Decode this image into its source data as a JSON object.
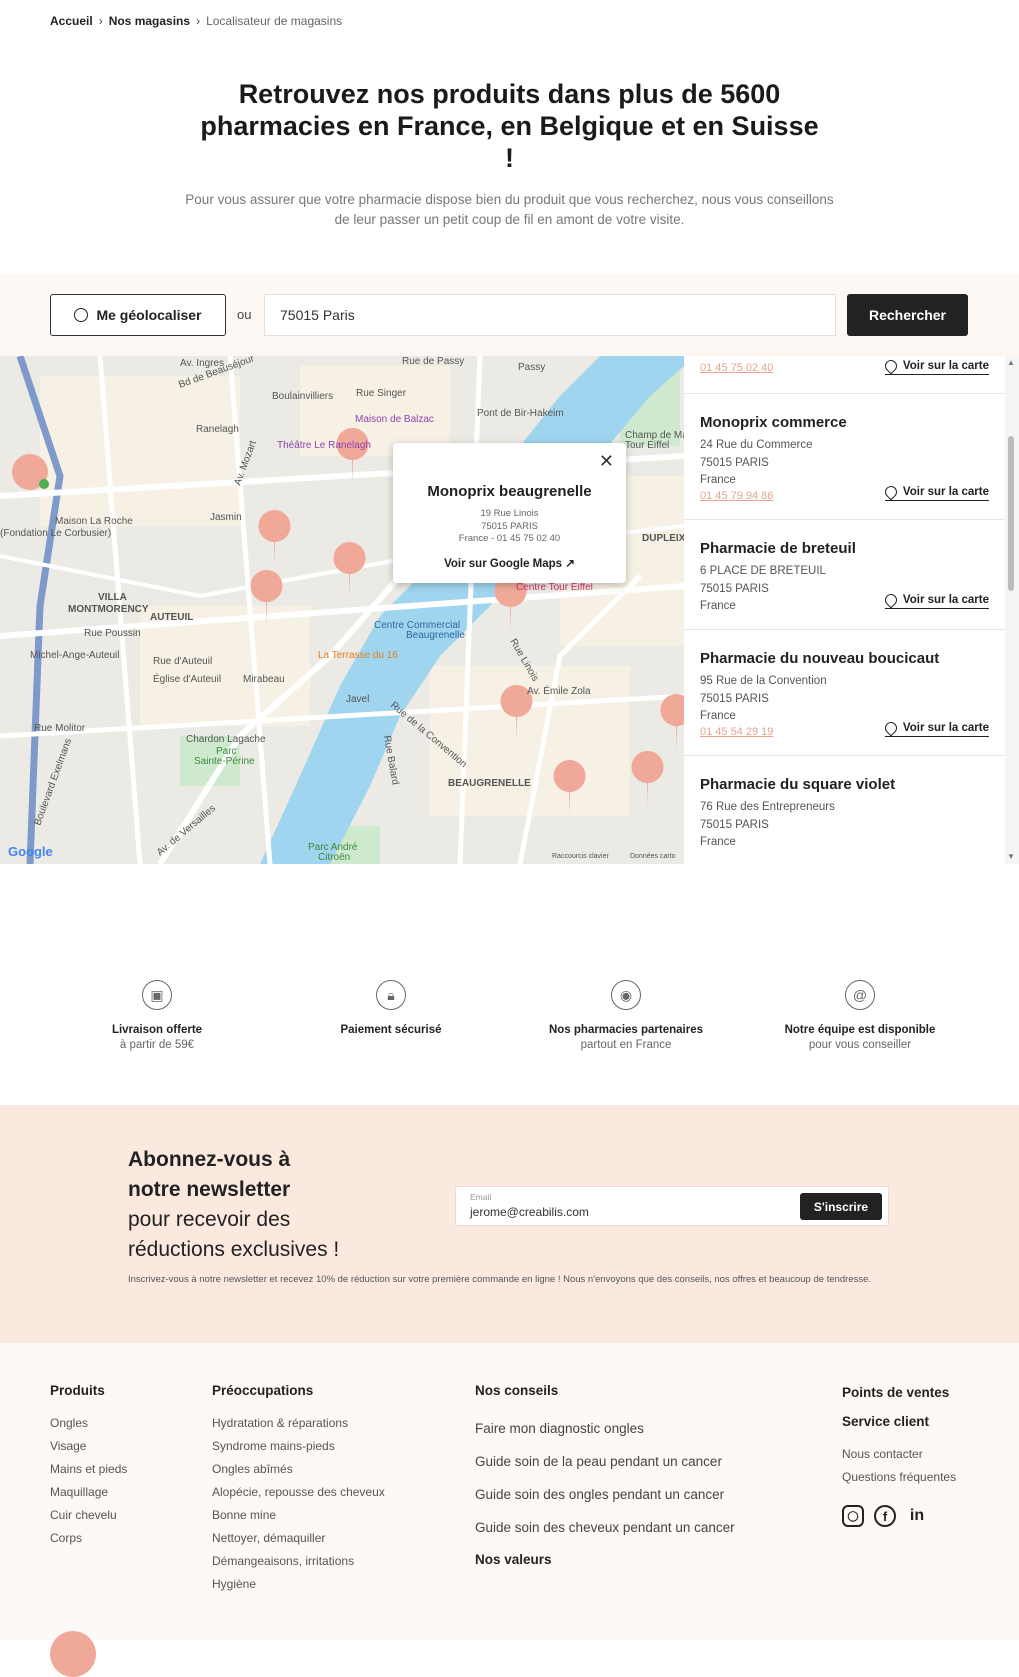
{
  "breadcrumb": {
    "home": "Accueil",
    "stores": "Nos magasins",
    "current": "Localisateur de magasins"
  },
  "hero": {
    "title": "Retrouvez nos produits dans plus de 5600 pharmacies en France, en Belgique et en Suisse !",
    "subtitle": "Pour vous assurer que votre pharmacie dispose bien du produit que vous recherchez, nous vous conseillons de leur passer un petit coup de fil en amont de votre visite."
  },
  "search": {
    "geolocate_label": "Me géolocaliser",
    "or_label": "ou",
    "input_value": "75015 Paris",
    "button_label": "Rechercher"
  },
  "map": {
    "labels": [
      "Rue de Passy",
      "Passy",
      "Bd de Beauséjour",
      "Av. Ingres",
      "Boulainvilliers",
      "Rue Singer",
      "Maison de Balzac",
      "Pont de Bir-Hakeim",
      "Champ de Mars Tour Eiffel",
      "Ranelagh",
      "Théâtre Le Ranelagh",
      "Av. Mozart",
      "Jasmin",
      "Maison La Roche (Fondation Le Corbusier)",
      "VILLA MONTMORENCY",
      "AUTEUIL",
      "Rue Poussin",
      "Michel-Ange-Auteuil",
      "Rue d'Auteuil",
      "Église d'Auteuil",
      "Mirabeau",
      "La Terrasse du 16",
      "Centre Commercial Beaugrenelle",
      "Centre Tour Eiffel",
      "Javel",
      "Rue Molitor",
      "Chardon Lagache",
      "Parc Sainte-Périne",
      "BEAUGRENELLE",
      "Av. Émile Zola",
      "Rue de la Convention",
      "Parc André Citroën",
      "DUPLEIX",
      "Rue Linois",
      "Boulevard Exelmans",
      "Av. de Versailles",
      "Rue Balard",
      "Google",
      "Raccourcis clavier",
      "Données carto"
    ],
    "popup": {
      "name": "Monoprix beaugrenelle",
      "address": "19 Rue Linois",
      "city": "75015 PARIS",
      "country_phone": "France - 01 45 75 02 40",
      "link": "Voir sur Google Maps"
    },
    "accent": "#f0a998",
    "water": "#9fd5ee"
  },
  "stores": {
    "partial_phone": "01 45 75 02 40",
    "view_label": "Voir sur la carte",
    "items": [
      {
        "name": "Monoprix commerce",
        "street": "24 Rue du Commerce",
        "city": "75015 PARIS",
        "country": "France",
        "phone": "01 45 79 94 86"
      },
      {
        "name": "Pharmacie de breteuil",
        "street": "6 PLACE DE BRETEUIL",
        "city": "75015 PARIS",
        "country": "France",
        "phone": ""
      },
      {
        "name": "Pharmacie du nouveau boucicaut",
        "street": "95 Rue de la Convention",
        "city": "75015 PARIS",
        "country": "France",
        "phone": "01 45 54 29 19"
      },
      {
        "name": "Pharmacie du square violet",
        "street": "76 Rue des Entrepreneurs",
        "city": "75015 PARIS",
        "country": "France",
        "phone": ""
      }
    ]
  },
  "features": [
    {
      "icon": "box-icon",
      "title": "Livraison offerte",
      "subtitle": "à partir de 59€"
    },
    {
      "icon": "lock-icon",
      "title": "Paiement sécurisé",
      "subtitle": ""
    },
    {
      "icon": "location-icon",
      "title": "Nos pharmacies partenaires",
      "subtitle": "partout en France"
    },
    {
      "icon": "at-icon",
      "title": "Notre équipe est disponible",
      "subtitle": "pour vous conseiller"
    }
  ],
  "newsletter": {
    "title_bold_1": "Abonnez-vous à",
    "title_bold_2": "notre newsletter",
    "title_light_1": "pour recevoir des",
    "title_light_2": "réductions exclusives !",
    "email_label": "Email",
    "email_value": "jerome@creabilis.com",
    "button_label": "S'inscrire",
    "legal": "Inscrivez-vous à notre newsletter et recevez 10% de réduction sur votre première commande en ligne ! Nous n'envoyons que des conseils, nos offres et beaucoup de tendresse."
  },
  "footer": {
    "products": {
      "title": "Produits",
      "items": [
        "Ongles",
        "Visage",
        "Mains et pieds",
        "Maquillage",
        "Cuir chevelu",
        "Corps"
      ]
    },
    "concerns": {
      "title": "Préoccupations",
      "items": [
        "Hydratation & réparations",
        "Syndrome mains-pieds",
        "Ongles abîmés",
        "Alopécie, repousse des cheveux",
        "Bonne mine",
        "Nettoyer, démaquiller",
        "Démangeaisons, irritations",
        "Hygiène"
      ]
    },
    "advice": {
      "title": "Nos conseils",
      "items": [
        "Faire mon diagnostic ongles",
        "Guide soin de la peau pendant un cancer",
        "Guide soin des ongles pendant un cancer",
        "Guide soin des cheveux pendant un cancer"
      ],
      "values": "Nos valeurs"
    },
    "points": {
      "title": "Points de ventes",
      "service": "Service client",
      "items": [
        "Nous contacter",
        "Questions fréquentes"
      ]
    },
    "social": [
      "instagram-icon",
      "facebook-icon",
      "linkedin-icon"
    ]
  }
}
